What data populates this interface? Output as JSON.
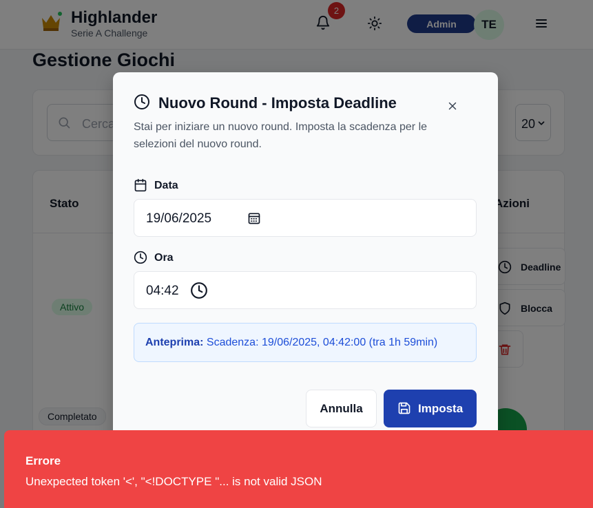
{
  "header": {
    "brand_title": "Highlander",
    "brand_subtitle": "Serie A Challenge",
    "notification_count": "2",
    "role_badge": "Admin",
    "avatar_initials": "TE"
  },
  "page": {
    "title": "Gestione Giochi",
    "search_placeholder": "Cerca...",
    "per_page": "20",
    "columns": {
      "status": "Stato",
      "actions": "Azioni"
    },
    "rows": [
      {
        "status": "Attivo",
        "actions": [
          "Deadline",
          "Blocca"
        ]
      },
      {
        "status": "Completato"
      }
    ]
  },
  "modal": {
    "title": "Nuovo Round - Imposta Deadline",
    "description": "Stai per iniziare un nuovo round. Imposta la scadenza per le selezioni del nuovo round.",
    "date_label": "Data",
    "date_value": "19/06/2025",
    "time_label": "Ora",
    "time_value": "04:42",
    "preview_label": "Anteprima:",
    "preview_text": "Scadenza: 19/06/2025, 04:42:00 (tra 1h 59min)",
    "cancel_label": "Annulla",
    "submit_label": "Imposta"
  },
  "toast": {
    "title": "Errore",
    "message": "Unexpected token '<', \"<!DOCTYPE \"... is not valid JSON"
  },
  "colors": {
    "primary": "#1e40af",
    "error": "#ef4444",
    "success": "#16a34a",
    "admin_badge": "#1e3a8a"
  },
  "icons": [
    "crown-icon",
    "bell-icon",
    "sun-icon",
    "menu-icon",
    "search-icon",
    "clock-icon",
    "close-icon",
    "calendar-icon",
    "save-icon",
    "shield-icon",
    "trash-icon"
  ]
}
